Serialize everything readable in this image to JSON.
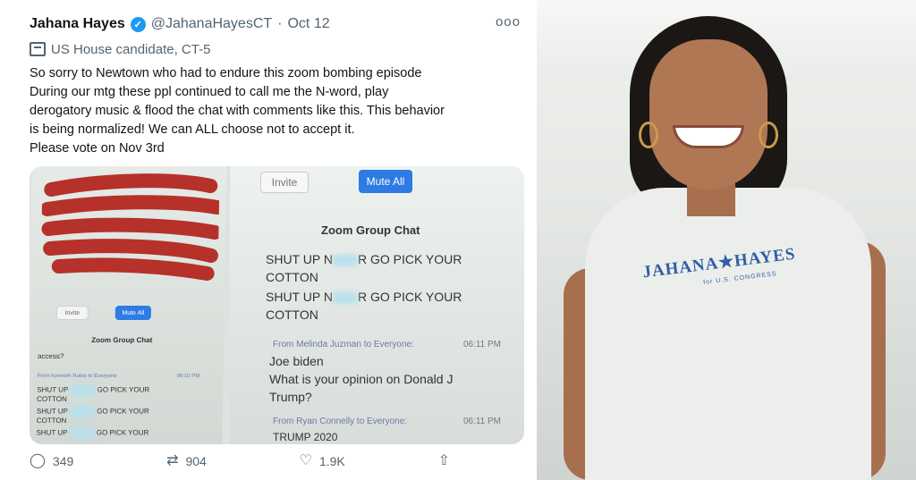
{
  "tweet": {
    "name": "Jahana Hayes",
    "handle": "@JahanaHayesCT",
    "separator": "·",
    "date": "Oct 12",
    "more": "ooo",
    "label": "US House candidate, CT-5",
    "lines": [
      "So sorry to Newtown who had to endure this zoom bombing episode",
      "During our mtg these ppl continued to call me the N-word, play",
      "derogatory music & flood the chat with comments like this. This behavior",
      "is being normalized! We can ALL choose not to accept it.",
      "Please vote on Nov 3rd"
    ],
    "actions": {
      "replies": "349",
      "retweets": "904",
      "likes": "1.9K"
    }
  },
  "screenshot_left": {
    "invite": "Invite",
    "mute_all": "Mute All",
    "title": "Zoom Group Chat",
    "question": "access?",
    "from": "From Kenneth Rubio to Everyone",
    "time": "06:10 PM",
    "messages": [
      "SHUT UP",
      "GO PICK YOUR",
      "COTTON",
      "SHUT UP",
      "GO PICK YOUR",
      "COTTON",
      "SHUT UP",
      "GO PICK YOUR"
    ]
  },
  "screenshot_right": {
    "invite": "Invite",
    "mute_all": "Mute All",
    "title": "Zoom Group Chat",
    "line1a": "SHUT UP N",
    "line1b": "R GO PICK YOUR",
    "line2": "COTTON",
    "line3a": "SHUT UP N",
    "line3b": "R GO PICK YOUR",
    "line4": "COTTON",
    "from1": "From Melinda Juzman to Everyone:",
    "time1": "06:11 PM",
    "msg1": "Joe biden",
    "msg2": "What is your opinion on Donald J",
    "msg3": "Trump?",
    "from2": "From Ryan Connelly to Everyone:",
    "time2": "06:11 PM",
    "msg4": "TRUMP 2020"
  },
  "photo": {
    "shirt_text": "JAHANA★HAYES",
    "shirt_subtext": "for U.S. CONGRESS"
  },
  "colors": {
    "twitter_blue": "#1d9bf0",
    "zoom_blue": "#2d7be3",
    "scribble_red": "#b5312a"
  }
}
